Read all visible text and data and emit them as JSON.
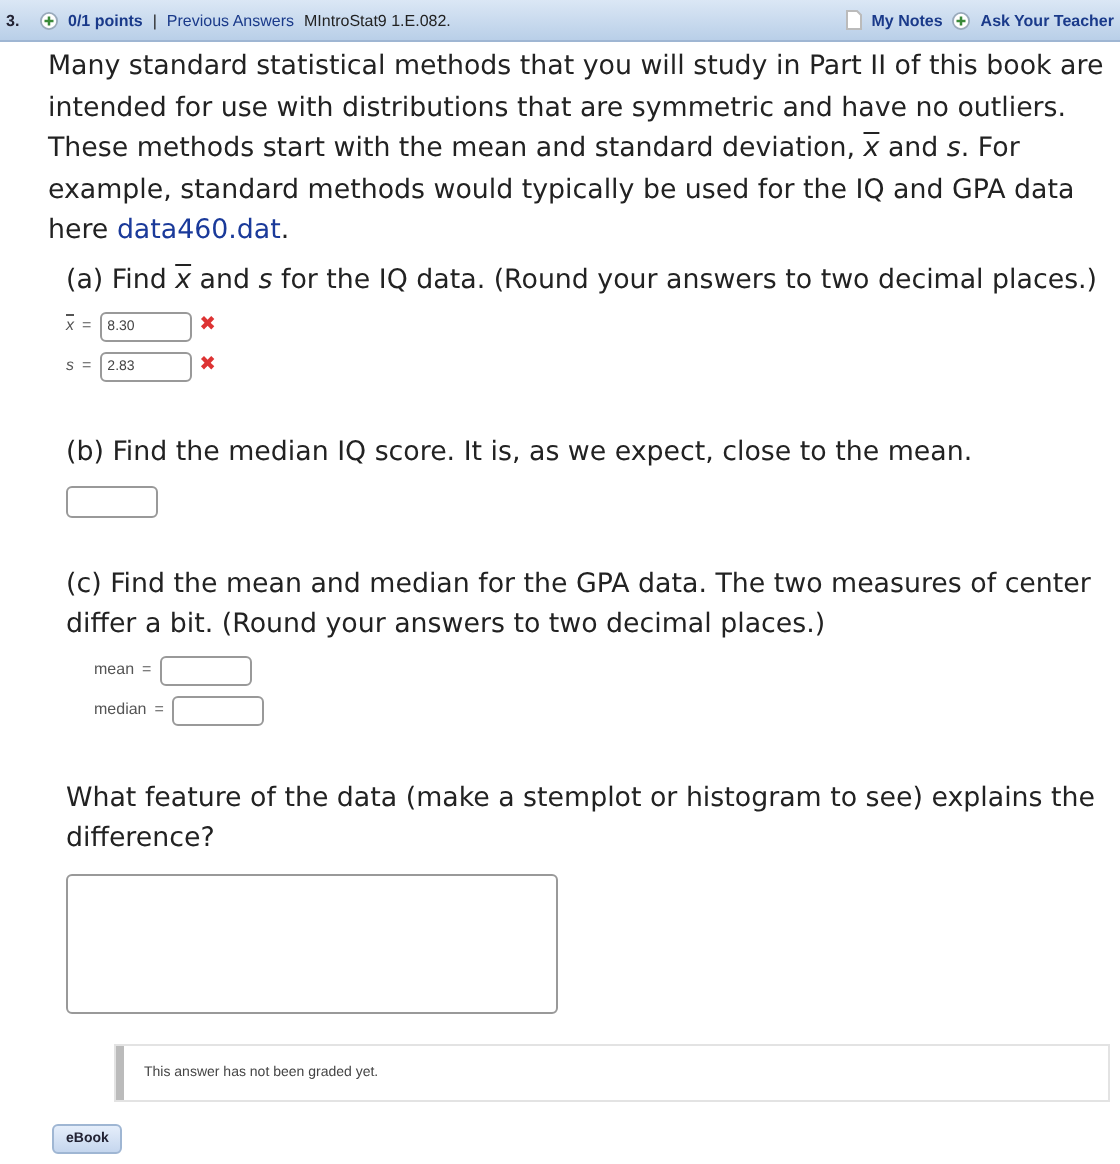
{
  "header": {
    "number": "3.",
    "points": "0/1 points",
    "separator": "|",
    "previous": "Previous Answers",
    "code": "MIntroStat9 1.E.082.",
    "notes": "My Notes",
    "ask": "Ask Your Teacher"
  },
  "intro": [
    {
      "kind": "plain",
      "text": "Many standard statistical methods that you will study in Part II of this book are intended for use with distributions that are symmetric and have no outliers. These methods start with the mean and standard deviation, "
    },
    {
      "kind": "bar",
      "text": "x"
    },
    {
      "kind": "plain",
      "text": " and "
    },
    {
      "kind": "italic",
      "text": "s"
    },
    {
      "kind": "plain",
      "text": ". For example, standard methods would typically be used for the IQ and GPA data here "
    },
    {
      "kind": "link",
      "text": "data460.dat"
    },
    {
      "kind": "plain",
      "text": "."
    }
  ],
  "parts": [
    {
      "kind": "labeled",
      "prompt": [
        {
          "kind": "plain",
          "text": "(a) Find "
        },
        {
          "kind": "bar",
          "text": "x"
        },
        {
          "kind": "plain",
          "text": " and "
        },
        {
          "kind": "italic",
          "text": "s"
        },
        {
          "kind": "plain",
          "text": " for the IQ data. (Round your answers to two decimal places.)"
        }
      ],
      "fields": [
        {
          "kind": "bar",
          "label": "x",
          "equals": "=",
          "value": "8.30",
          "mark": "✖"
        },
        {
          "kind": "italic",
          "label": "s",
          "equals": "=",
          "value": "2.83",
          "mark": "✖"
        }
      ]
    },
    {
      "kind": "single",
      "prompt": [
        {
          "kind": "plain",
          "text": "(b) Find the median IQ score. It is, as we expect, close to the mean."
        }
      ]
    },
    {
      "kind": "labeled",
      "prompt": [
        {
          "kind": "plain",
          "text": "(c) Find the mean and median for the GPA data. The two measures of center differ a bit. (Round your answers to two decimal places.)"
        }
      ],
      "fields": [
        {
          "kind": "plain",
          "label": "mean",
          "equals": "="
        },
        {
          "kind": "plain",
          "label": "median",
          "equals": "="
        }
      ]
    },
    {
      "kind": "essay",
      "prompt": [
        {
          "kind": "plain",
          "text": "What feature of the data (make a stemplot or histogram to see) explains the difference?"
        }
      ]
    }
  ],
  "grading_note": "This answer has not been graded yet.",
  "ebook": "eBook"
}
